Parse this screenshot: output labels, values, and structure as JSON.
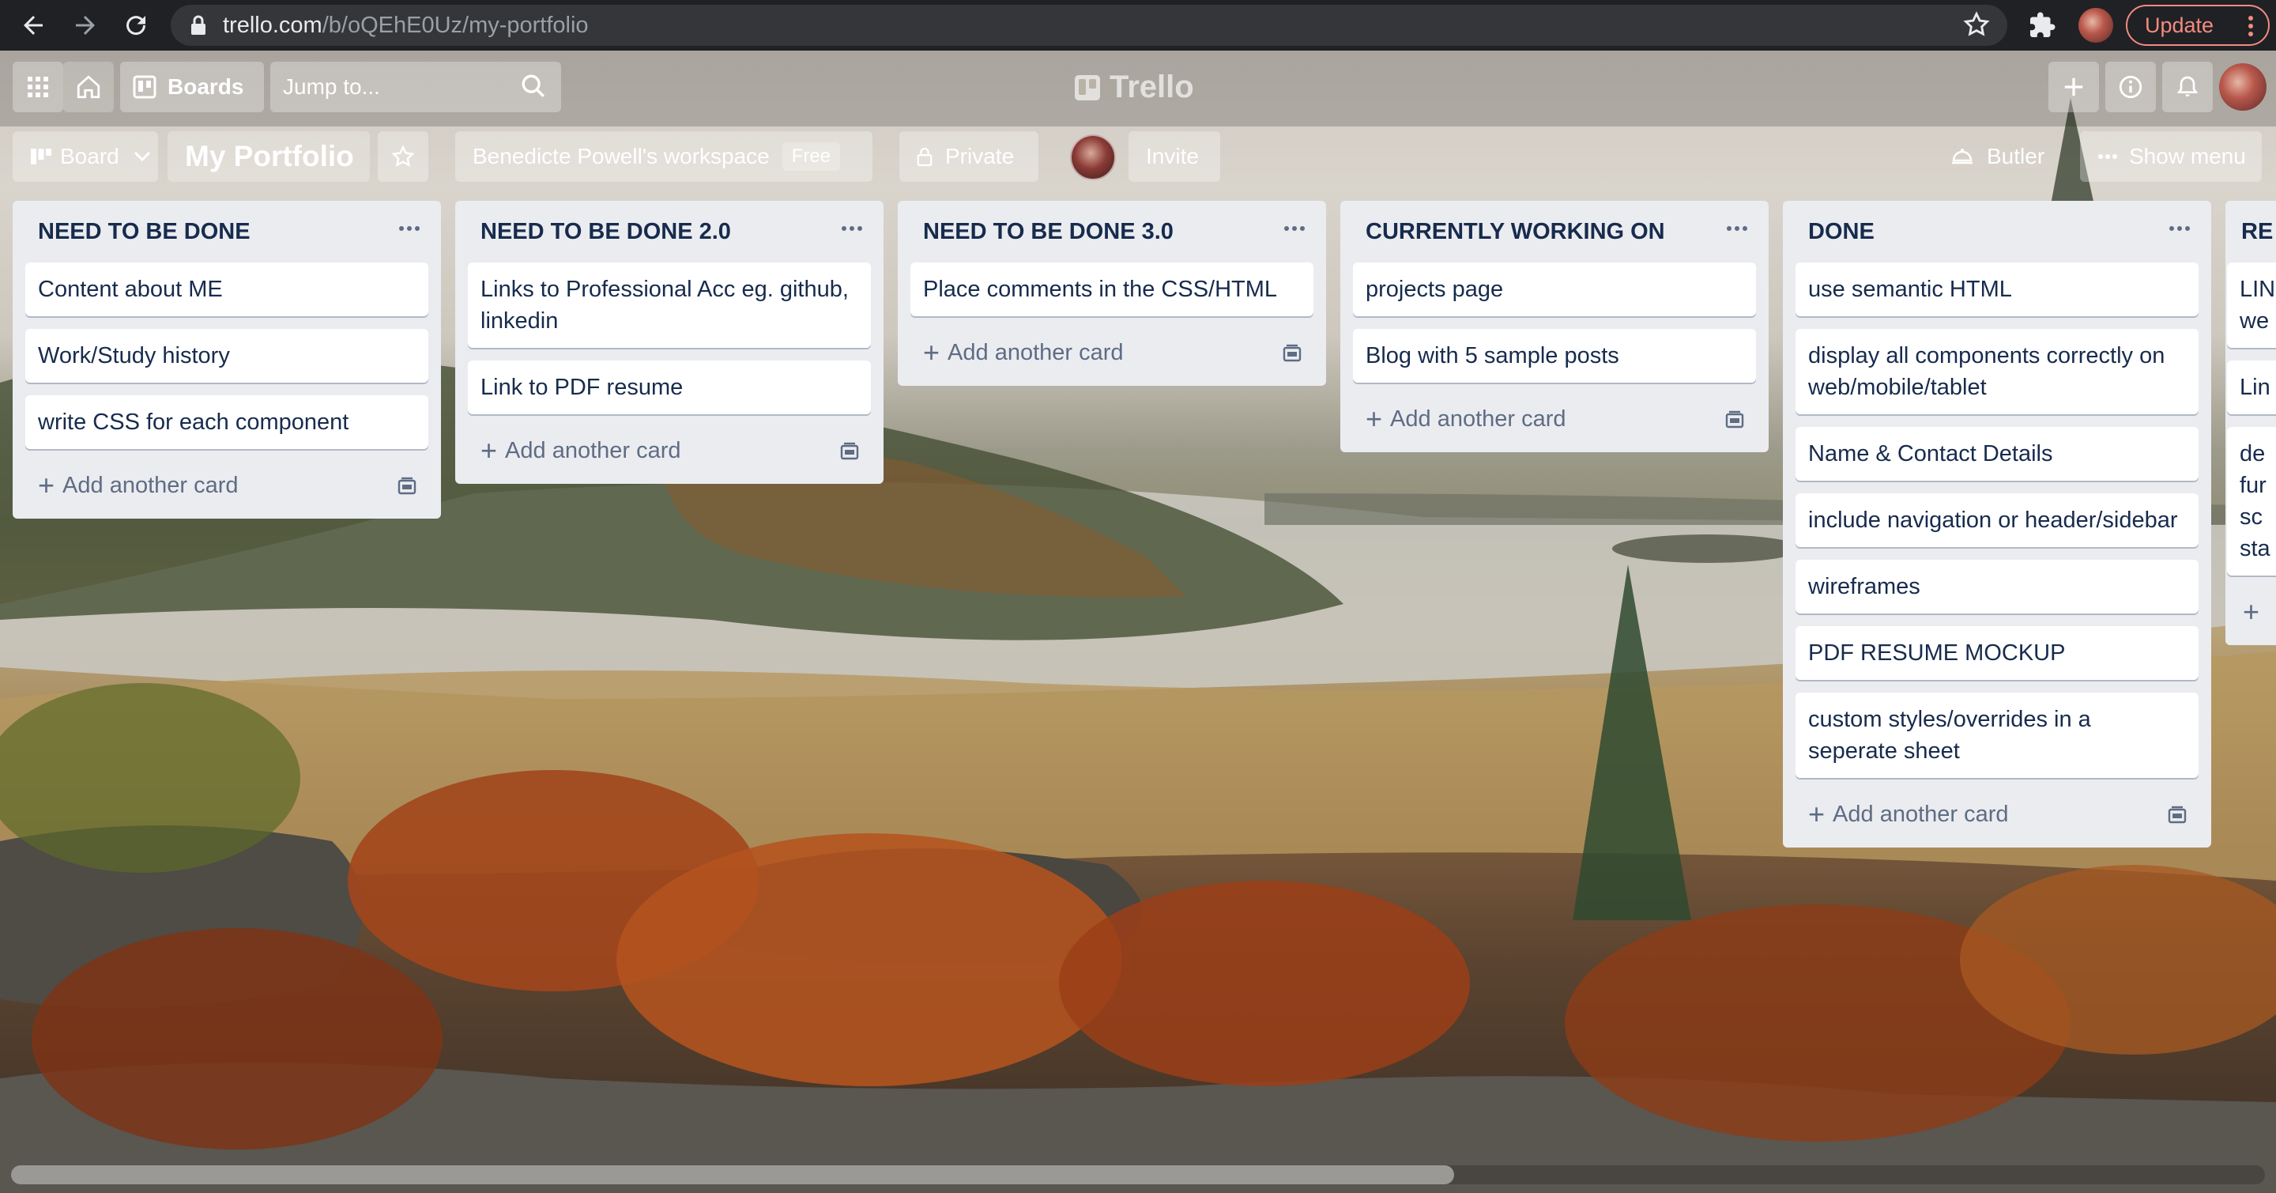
{
  "browser": {
    "url_host": "trello.com",
    "url_path": "/b/oQEhE0Uz/my-portfolio",
    "update_label": "Update"
  },
  "header": {
    "boards_label": "Boards",
    "search_placeholder": "Jump to...",
    "logo_text": "Trello"
  },
  "board": {
    "view_label": "Board",
    "title": "My Portfolio",
    "workspace": "Benedicte Powell's workspace",
    "workspace_badge": "Free",
    "visibility": "Private",
    "invite_label": "Invite",
    "butler_label": "Butler",
    "menu_label": "Show menu"
  },
  "add_card_label": "Add another card",
  "lists": [
    {
      "title": "NEED TO BE DONE",
      "cards": [
        "Content about ME",
        "Work/Study history",
        "write CSS for each component"
      ]
    },
    {
      "title": "NEED TO BE DONE 2.0",
      "cards": [
        "Links to Professional Acc eg. github, linkedin",
        "Link to PDF resume"
      ]
    },
    {
      "title": "NEED TO BE DONE 3.0",
      "cards": [
        "Place comments in the CSS/HTML"
      ]
    },
    {
      "title": "CURRENTLY WORKING ON",
      "cards": [
        "projects page",
        "Blog with 5 sample posts"
      ]
    },
    {
      "title": "DONE",
      "cards": [
        "use semantic HTML",
        "display all components correctly on web/mobile/tablet",
        "Name & Contact Details",
        "include navigation or header/sidebar",
        "wireframes",
        "PDF RESUME MOCKUP",
        "custom styles/overrides in a seperate sheet"
      ]
    },
    {
      "title": "RE",
      "cards": [
        "LIN we",
        "Lin",
        "de fur sc sta"
      ]
    }
  ],
  "colors": {
    "list_bg": "#ebecf0",
    "card_text": "#172b4d",
    "muted_text": "#5e6c84",
    "update_accent": "#f28b82"
  },
  "icons": [
    "back-arrow-icon",
    "forward-arrow-icon",
    "reload-icon",
    "lock-icon",
    "star-icon",
    "extensions-icon",
    "apps-grid-icon",
    "home-icon",
    "boards-icon",
    "search-icon",
    "plus-icon",
    "info-icon",
    "bell-icon",
    "chevron-down-icon",
    "butler-icon",
    "ellipsis-icon",
    "card-template-icon"
  ]
}
